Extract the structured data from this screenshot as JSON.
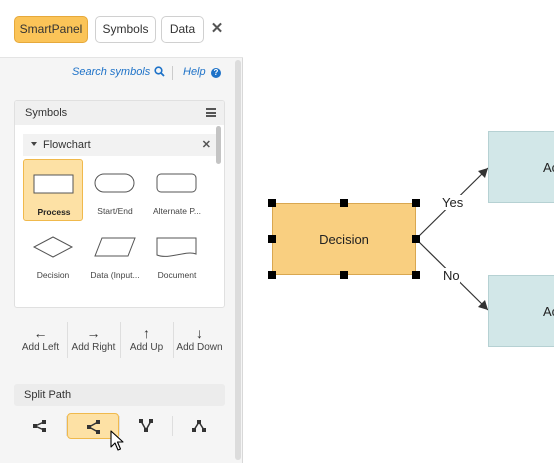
{
  "tabs": [
    {
      "label": "SmartPanel",
      "active": true
    },
    {
      "label": "Symbols",
      "active": false
    },
    {
      "label": "Data",
      "active": false
    }
  ],
  "tools": {
    "search_label": "Search symbols",
    "help_label": "Help"
  },
  "symbols_panel": {
    "title": "Symbols",
    "category": "Flowchart",
    "items": [
      {
        "label": "Process",
        "icon": "process-rect-icon",
        "selected": true
      },
      {
        "label": "Start/End",
        "icon": "terminator-icon",
        "selected": false
      },
      {
        "label": "Alternate P...",
        "icon": "alternate-process-icon",
        "selected": false
      },
      {
        "label": "Decision",
        "icon": "diamond-icon",
        "selected": false
      },
      {
        "label": "Data (Input...",
        "icon": "parallelogram-icon",
        "selected": false
      },
      {
        "label": "Document",
        "icon": "document-icon",
        "selected": false
      }
    ]
  },
  "direction_buttons": [
    {
      "label": "Add Left",
      "icon": "arrow-left-icon"
    },
    {
      "label": "Add Right",
      "icon": "arrow-right-icon"
    },
    {
      "label": "Add Up",
      "icon": "arrow-up-icon"
    },
    {
      "label": "Add Down",
      "icon": "arrow-down-icon"
    }
  ],
  "split_path": {
    "title": "Split Path",
    "active_index": 1,
    "icons": [
      "split-two-right-icon",
      "split-three-right-icon",
      "split-three-down-icon",
      "split-tree-icon"
    ]
  },
  "canvas": {
    "decision_label": "Decision",
    "action_top_label": "Ac",
    "action_bottom_label": "Ac",
    "yes_label": "Yes",
    "no_label": "No"
  },
  "colors": {
    "active_tab": "#fbc458",
    "selected_item": "#fde1a5",
    "decision_fill": "#f9cf80",
    "action_fill": "#d2e7e8",
    "link": "#1e72c8"
  }
}
